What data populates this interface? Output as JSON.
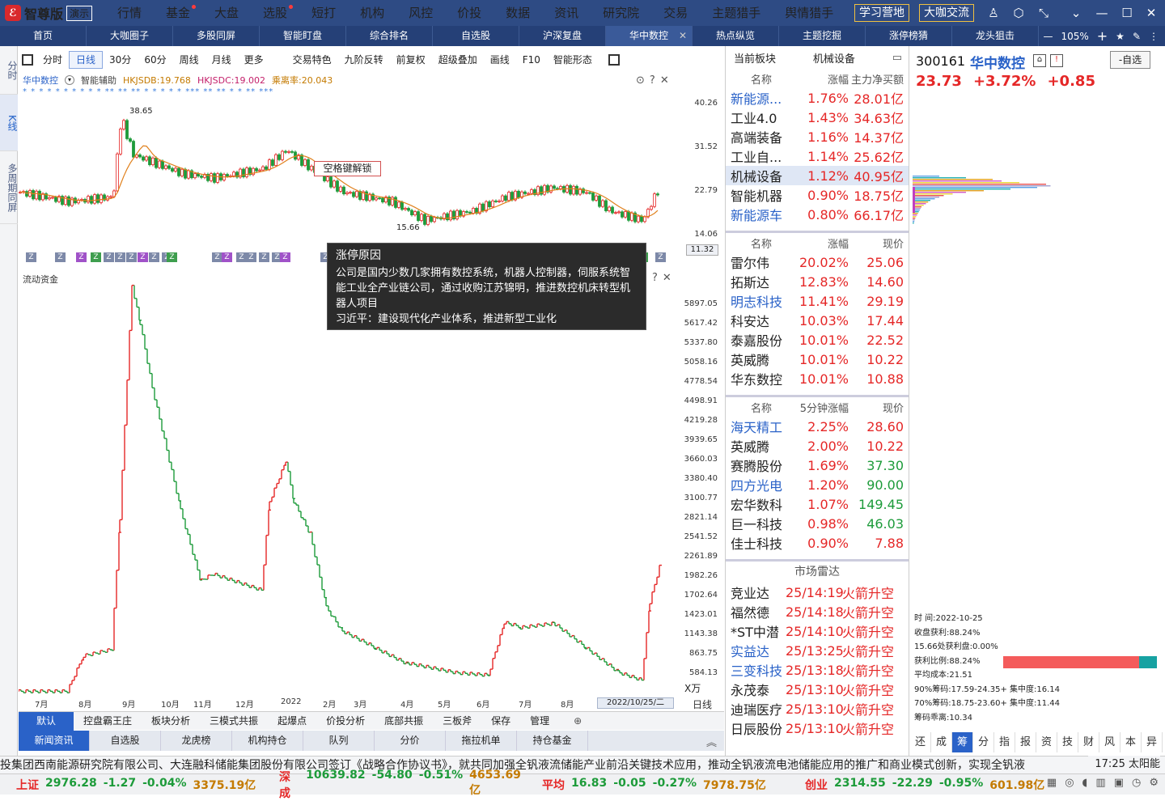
{
  "app": {
    "name": "智尊版",
    "demo_badge": "演示"
  },
  "menu": [
    {
      "label": "行情",
      "dot": false
    },
    {
      "label": "基金",
      "dot": true
    },
    {
      "label": "大盘",
      "dot": false
    },
    {
      "label": "选股",
      "dot": true
    },
    {
      "label": "短打",
      "dot": false
    },
    {
      "label": "机构",
      "dot": false
    },
    {
      "label": "风控",
      "dot": false
    },
    {
      "label": "价投",
      "dot": false
    },
    {
      "label": "数据",
      "dot": false
    },
    {
      "label": "资讯",
      "dot": false
    },
    {
      "label": "研究院",
      "dot": false
    },
    {
      "label": "交易",
      "dot": false
    },
    {
      "label": "主题猎手",
      "dot": false
    },
    {
      "label": "舆情猎手",
      "dot": false
    }
  ],
  "top_buttons": {
    "study": "学习营地",
    "talk": "大咖交流"
  },
  "tabs": [
    "首页",
    "大咖圈子",
    "多股同屏",
    "智能盯盘",
    "综合排名",
    "自选股",
    "沪深复盘",
    "华中数控",
    "热点纵览",
    "主题挖掘",
    "涨停榜猜",
    "龙头狙击"
  ],
  "active_tab": "华中数控",
  "tab_tools": {
    "zoom": "105%"
  },
  "left_side": [
    "分时",
    "K线",
    "多周期同屏"
  ],
  "chart_toolbar": [
    "分时",
    "日线",
    "30分",
    "60分",
    "周线",
    "月线",
    "更多",
    "交易特色",
    "九阶反转",
    "前复权",
    "超级叠加",
    "画线",
    "F10",
    "智能形态"
  ],
  "chart_toolbar_active": "日线",
  "nine_badge": "9",
  "kline_info": {
    "name": "华中数控",
    "assist": "智能辅助",
    "hkjsdb": "HKJSDB:19.768",
    "hkjsdc": "HKJSDC:19.002",
    "deviation": "乘离率:20.043"
  },
  "kline_labels": {
    "high": "38.65",
    "low": "15.66",
    "unlock": "空格键解锁"
  },
  "kline_axis": [
    "40.26",
    "31.52",
    "22.79",
    "14.06"
  ],
  "kline_current": "11.32",
  "flow_label": "流动资金",
  "flow_axis": [
    "5897.05",
    "5617.42",
    "5337.80",
    "5058.16",
    "4778.54",
    "4498.91",
    "4219.28",
    "3939.65",
    "3660.03",
    "3380.40",
    "3100.77",
    "2821.14",
    "2541.52",
    "2261.89",
    "1982.26",
    "1702.64",
    "1423.01",
    "1143.38",
    "863.75",
    "584.13"
  ],
  "flow_unit": "X万",
  "x_axis": [
    "7月",
    "8月",
    "9月",
    "10月",
    "11月",
    "12月",
    "2022",
    "2月",
    "3月",
    "4月",
    "5月",
    "6月",
    "7月",
    "8月"
  ],
  "x_date": "2022/10/25/二",
  "x_period": "日线",
  "tooltip": {
    "title": "涨停原因",
    "body": "公司是国内少数几家拥有数控系统，机器人控制器，伺服系统智能工业全产业链公司，通过收购江苏锦明，推进数控机床转型机器人项目",
    "policy": "习近平：建设现代化产业体系，推进新型工业化"
  },
  "sub_tabs1": [
    "默认",
    "控盘霸王庄",
    "板块分析",
    "三模式共振",
    "起爆点",
    "价投分析",
    "底部共振",
    "三板斧",
    "保存",
    "管理"
  ],
  "sub_tabs2": [
    "新闻资讯",
    "自选股",
    "龙虎榜",
    "机构持仓",
    "队列",
    "分价",
    "拖拉机单",
    "持仓基金"
  ],
  "sector": {
    "title": "当前板块",
    "subtitle": "机械设备",
    "headers": [
      "名称",
      "涨幅",
      "主力净买额"
    ],
    "rows": [
      {
        "name": "新能源...",
        "chg": "1.76%",
        "val": "28.01亿",
        "blue": true
      },
      {
        "name": "工业4.0",
        "chg": "1.43%",
        "val": "34.63亿",
        "blue": false
      },
      {
        "name": "高端装备",
        "chg": "1.16%",
        "val": "14.37亿",
        "blue": false
      },
      {
        "name": "工业自...",
        "chg": "1.14%",
        "val": "25.62亿",
        "blue": false
      },
      {
        "name": "机械设备",
        "chg": "1.12%",
        "val": "40.95亿",
        "blue": false
      },
      {
        "name": "智能机器",
        "chg": "0.90%",
        "val": "18.75亿",
        "blue": false
      },
      {
        "name": "新能源车",
        "chg": "0.80%",
        "val": "66.17亿",
        "blue": true
      }
    ]
  },
  "gainers": {
    "headers": [
      "名称",
      "涨幅",
      "现价"
    ],
    "rows": [
      {
        "name": "雷尔伟",
        "chg": "20.02%",
        "val": "25.06",
        "blue": false
      },
      {
        "name": "拓斯达",
        "chg": "12.83%",
        "val": "14.60",
        "blue": false
      },
      {
        "name": "明志科技",
        "chg": "11.41%",
        "val": "29.19",
        "blue": true
      },
      {
        "name": "科安达",
        "chg": "10.03%",
        "val": "17.44",
        "blue": false
      },
      {
        "name": "泰嘉股份",
        "chg": "10.01%",
        "val": "22.52",
        "blue": false
      },
      {
        "name": "英威腾",
        "chg": "10.01%",
        "val": "10.22",
        "blue": false
      },
      {
        "name": "华东数控",
        "chg": "10.01%",
        "val": "10.88",
        "blue": false
      }
    ]
  },
  "fivemin": {
    "headers": [
      "名称",
      "5分钟涨幅",
      "现价"
    ],
    "rows": [
      {
        "name": "海天精工",
        "chg": "2.25%",
        "val": "28.60",
        "blue": true
      },
      {
        "name": "英威腾",
        "chg": "2.00%",
        "val": "10.22",
        "blue": false
      },
      {
        "name": "赛腾股份",
        "chg": "1.69%",
        "val": "37.30",
        "blue": false
      },
      {
        "name": "四方光电",
        "chg": "1.20%",
        "val": "90.00",
        "blue": true
      },
      {
        "name": "宏华数科",
        "chg": "1.07%",
        "val": "149.45",
        "blue": false
      },
      {
        "name": "巨一科技",
        "chg": "0.98%",
        "val": "46.03",
        "blue": false
      },
      {
        "name": "佳士科技",
        "chg": "0.90%",
        "val": "7.88",
        "blue": false
      }
    ]
  },
  "radar": {
    "title": "市场雷达",
    "rows": [
      {
        "name": "竞业达",
        "time": "25/14:19",
        "event": "火箭升空",
        "blue": false
      },
      {
        "name": "福然德",
        "time": "25/14:18",
        "event": "火箭升空",
        "blue": false
      },
      {
        "name": "*ST中潜",
        "time": "25/14:10",
        "event": "火箭升空",
        "blue": false
      },
      {
        "name": "实益达",
        "time": "25/13:25",
        "event": "火箭升空",
        "blue": true
      },
      {
        "name": "三变科技",
        "time": "25/13:18",
        "event": "火箭升空",
        "blue": true
      },
      {
        "name": "永茂泰",
        "time": "25/13:10",
        "event": "火箭升空",
        "blue": false
      },
      {
        "name": "迪瑞医疗",
        "time": "25/13:10",
        "event": "火箭升空",
        "blue": false
      },
      {
        "name": "日辰股份",
        "time": "25/13:10",
        "event": "火箭升空",
        "blue": false
      }
    ]
  },
  "quote": {
    "code": "300161",
    "name": "华中数控",
    "price": "23.73",
    "pct": "+3.72%",
    "chg": "+0.85",
    "add": "-自选"
  },
  "chip": {
    "time_label": "时        间:2022-10-25",
    "profit_close": "收盘获利:88.24%",
    "profit_15": "15.66处获利盘:0.00%",
    "profit_ratio": "获利比例:88.24%",
    "avg_cost": "平均成本:21.51",
    "c90": "90%筹码:17.59-24.35+ 集中度:16.14",
    "c70": "70%筹码:18.75-23.60+ 集中度:11.44",
    "deviation": "筹码乖离:10.34",
    "profit_fraction": 0.8824
  },
  "right_tabs": [
    "还",
    "成",
    "筹",
    "分",
    "指",
    "报",
    "资",
    "技",
    "财",
    "风",
    "本",
    "异"
  ],
  "right_tab_active": "筹",
  "ticker": "投集团西南能源研究院有限公司、大连融科储能集团股份有限公司签订《战略合作协议书》，就共同加强全钒液流储能产业前沿关键技术应用，推动全钒液流电池储能应用的推广和商业模式创新，实现全钒液",
  "ticker_time": "17:25 太阳能",
  "indices": [
    {
      "name": "上证",
      "price": "2976.28",
      "chg": "-1.27",
      "pct": "-0.04%",
      "amt": "3375.19亿"
    },
    {
      "name": "深成",
      "price": "10639.82",
      "chg": "-54.80",
      "pct": "-0.51%",
      "amt": "4653.69亿"
    },
    {
      "name": "平均",
      "price": "16.83",
      "chg": "-0.05",
      "pct": "-0.27%",
      "amt": "7978.75亿"
    },
    {
      "name": "创业",
      "price": "2314.55",
      "chg": "-22.29",
      "pct": "-0.95%",
      "amt": "601.98亿"
    }
  ],
  "colors": {
    "up": "#e52727",
    "down": "#1d9b3a",
    "accent": "#2a62c8",
    "header": "#2e4b84"
  }
}
